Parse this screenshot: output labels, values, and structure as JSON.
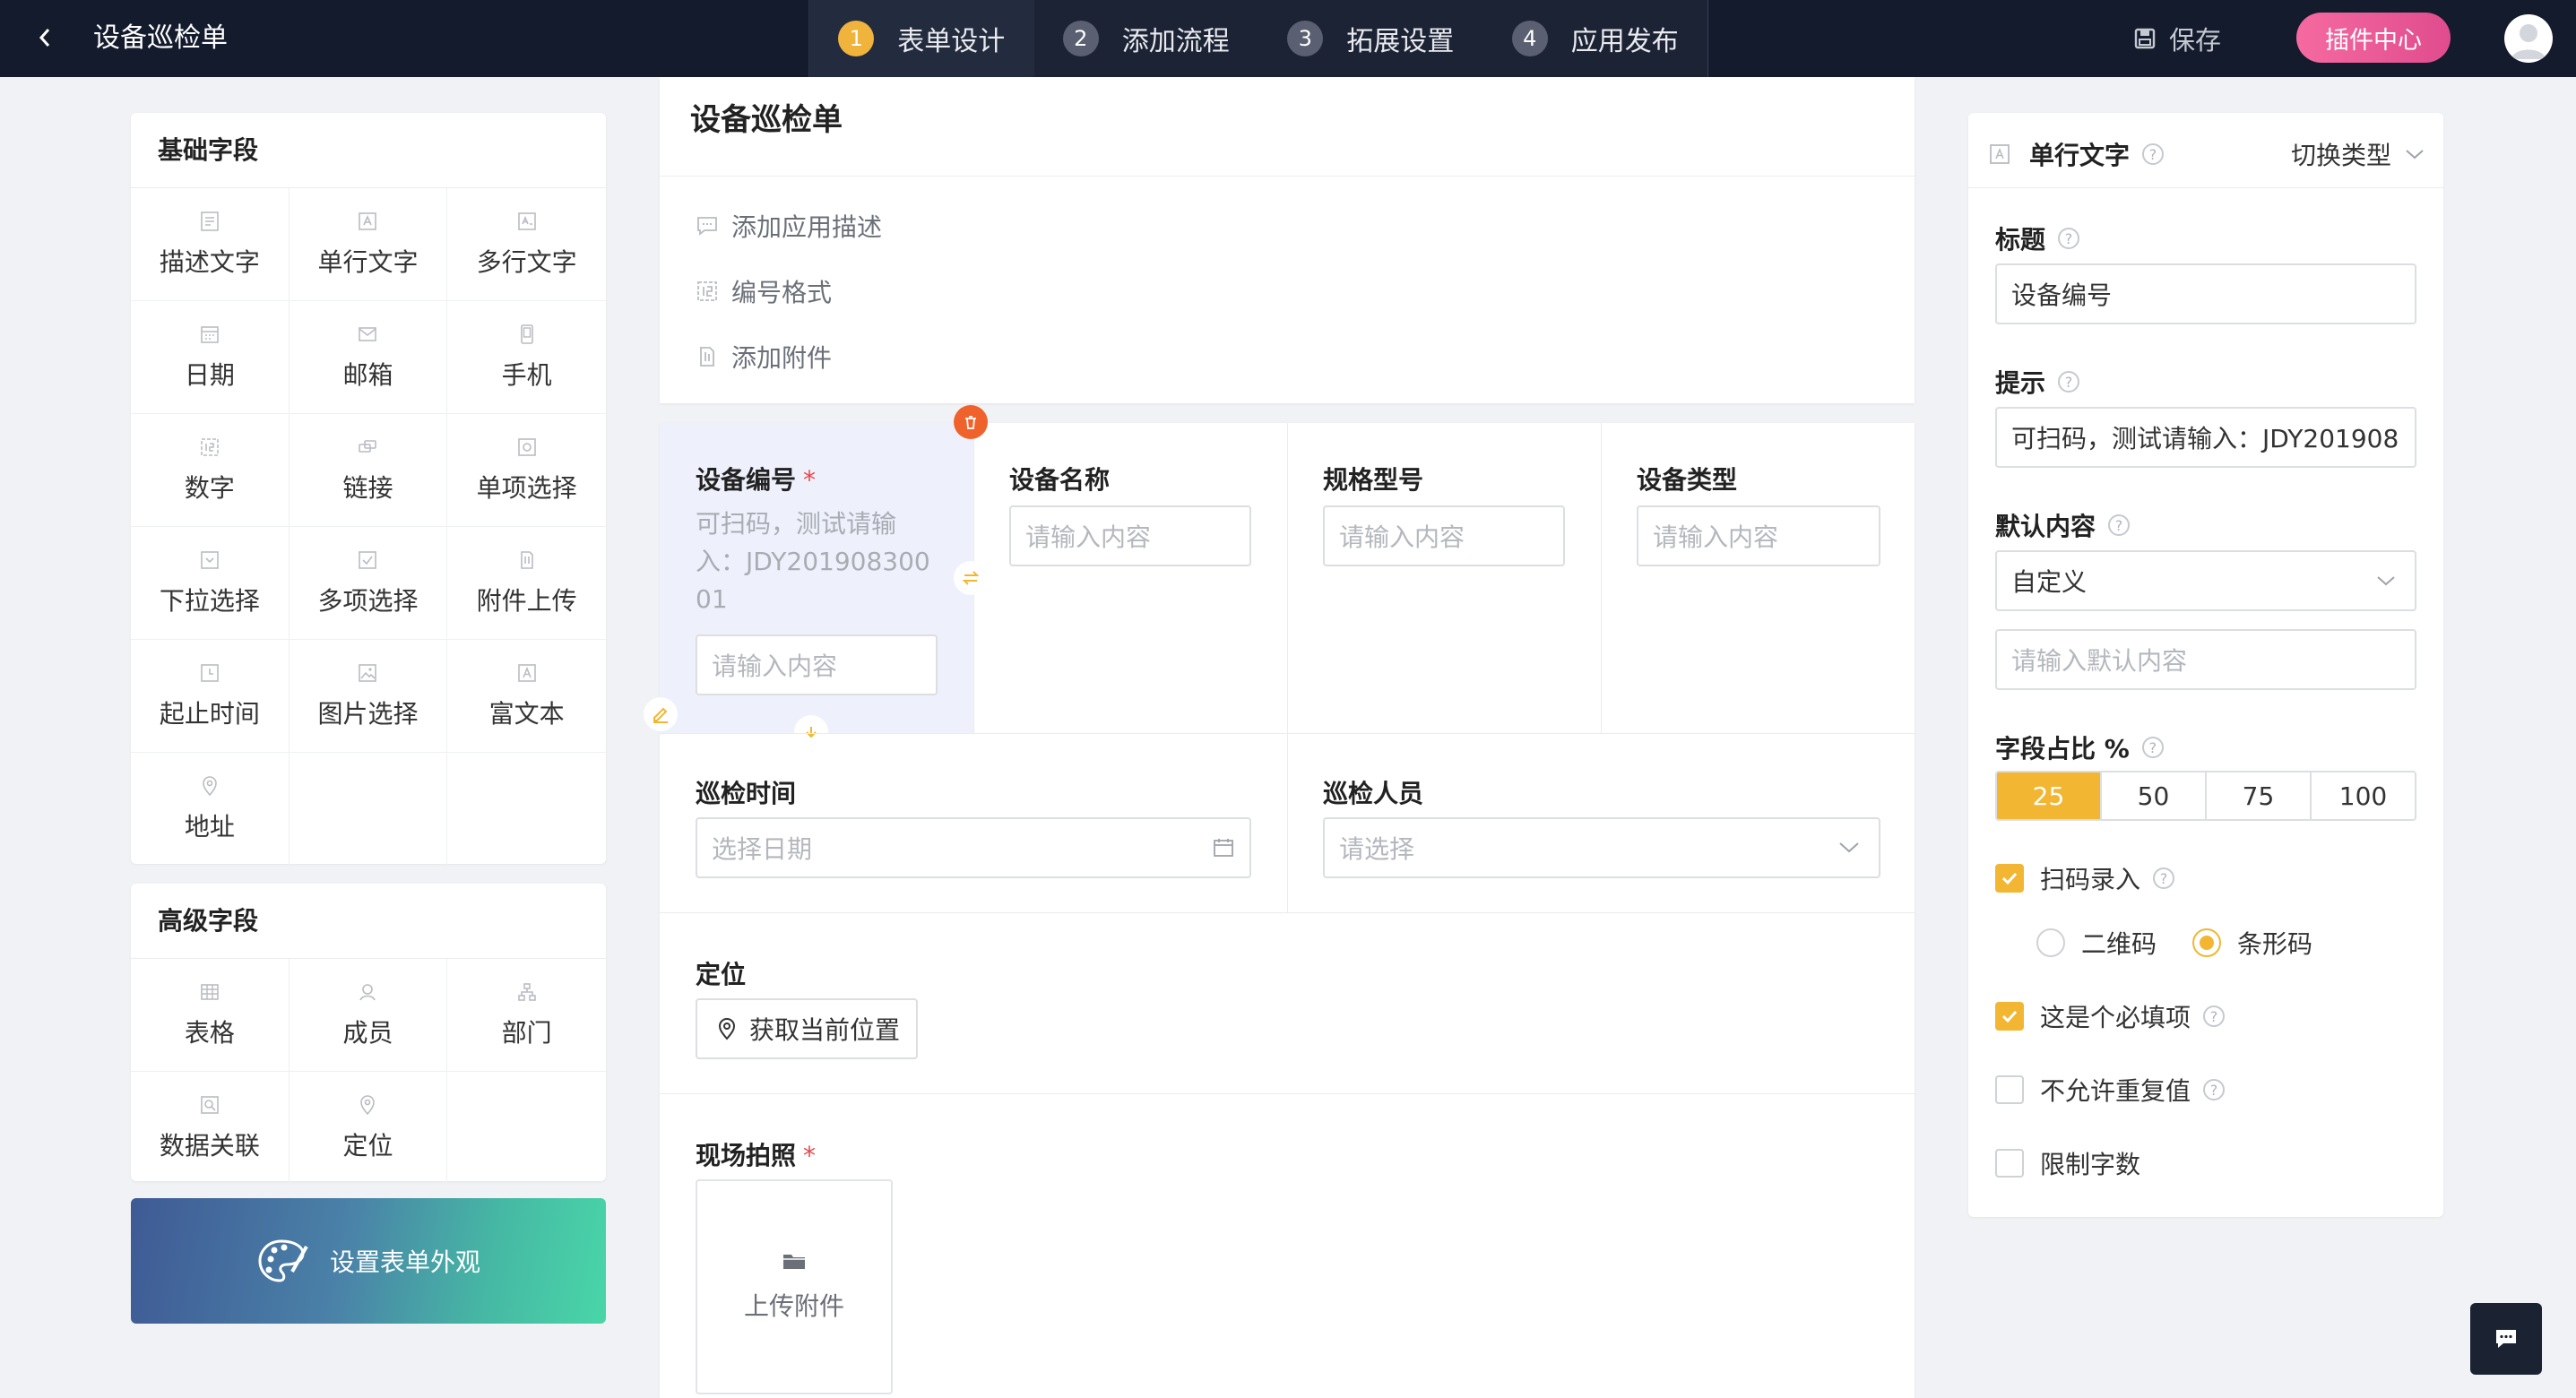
{
  "header": {
    "app_title": "设备巡检单",
    "steps": [
      {
        "num": "1",
        "label": "表单设计"
      },
      {
        "num": "2",
        "label": "添加流程"
      },
      {
        "num": "3",
        "label": "拓展设置"
      },
      {
        "num": "4",
        "label": "应用发布"
      }
    ],
    "save_label": "保存",
    "plugin_label": "插件中心"
  },
  "left": {
    "basic_title": "基础字段",
    "basic_fields": [
      "描述文字",
      "单行文字",
      "多行文字",
      "日期",
      "邮箱",
      "手机",
      "数字",
      "链接",
      "单项选择",
      "下拉选择",
      "多项选择",
      "附件上传",
      "起止时间",
      "图片选择",
      "富文本",
      "地址"
    ],
    "advanced_title": "高级字段",
    "advanced_fields": [
      "表格",
      "成员",
      "部门",
      "数据关联",
      "定位"
    ],
    "theme_label": "设置表单外观"
  },
  "form": {
    "title": "设备巡检单",
    "options": [
      "添加应用描述",
      "编号格式",
      "添加附件"
    ],
    "fields": {
      "device_no": {
        "label": "设备编号",
        "required": "*",
        "hint": "可扫码，测试请输入：JDY20190830001",
        "placeholder": "请输入内容"
      },
      "device_name": {
        "label": "设备名称",
        "placeholder": "请输入内容"
      },
      "model": {
        "label": "规格型号",
        "placeholder": "请输入内容"
      },
      "device_type": {
        "label": "设备类型",
        "placeholder": "请输入内容"
      },
      "inspect_time": {
        "label": "巡检时间",
        "placeholder": "选择日期"
      },
      "inspector": {
        "label": "巡检人员",
        "placeholder": "请选择"
      },
      "location": {
        "label": "定位",
        "button": "获取当前位置"
      },
      "photo": {
        "label": "现场拍照",
        "required": "*",
        "upload": "上传附件"
      }
    }
  },
  "right": {
    "field_type": "单行文字",
    "switch_type": "切换类型",
    "title_label": "标题",
    "title_value": "设备编号",
    "hint_label": "提示",
    "hint_value": "可扫码，测试请输入：JDY201908",
    "default_label": "默认内容",
    "default_mode": "自定义",
    "default_placeholder": "请输入默认内容",
    "ratio_label": "字段占比 %",
    "ratios": [
      "25",
      "50",
      "75",
      "100"
    ],
    "selected_ratio": "25",
    "scan_label": "扫码录入",
    "scan_options": [
      "二维码",
      "条形码"
    ],
    "scan_selected": "条形码",
    "required_label": "这是个必填项",
    "nodup_label": "不允许重复值",
    "limit_label": "限制字数"
  },
  "colors": {
    "accent": "#f2b632",
    "topbar": "#141b2d",
    "plugin": "#e95598"
  }
}
